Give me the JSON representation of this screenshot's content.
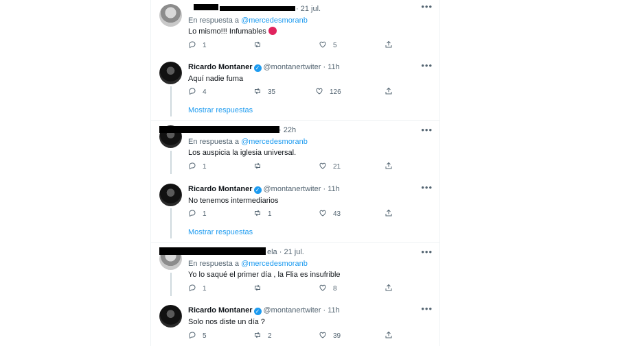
{
  "tweets": [
    {
      "id": "t1",
      "time": "21 jul.",
      "reply_prefix": "En respuesta a",
      "reply_handle": "@mercedesmoranb",
      "text": "Lo mismo!!! Infumables",
      "counts": {
        "reply": "1",
        "retweet": "",
        "like": "5"
      }
    },
    {
      "id": "t2",
      "name": "Ricardo Montaner",
      "handle": "@montanertwiter",
      "time": "11h",
      "text": "Aquí nadie fuma",
      "counts": {
        "reply": "4",
        "retweet": "35",
        "like": "126"
      }
    },
    {
      "id": "t3",
      "time": "22h",
      "reply_prefix": "En respuesta a",
      "reply_handle": "@mercedesmoranb",
      "text": "Los auspicia la iglesia universal.",
      "counts": {
        "reply": "1",
        "retweet": "",
        "like": "21"
      }
    },
    {
      "id": "t4",
      "name": "Ricardo Montaner",
      "handle": "@montanertwiter",
      "time": "11h",
      "text": "No tenemos intermediarios",
      "counts": {
        "reply": "1",
        "retweet": "1",
        "like": "43"
      }
    },
    {
      "id": "t5",
      "name_fragment": "ela",
      "time": "21 jul.",
      "reply_prefix": "En respuesta a",
      "reply_handle": "@mercedesmoranb",
      "text": "Yo lo saqué el primer día , la Flia es insufrible",
      "counts": {
        "reply": "1",
        "retweet": "",
        "like": "8"
      }
    },
    {
      "id": "t6",
      "name": "Ricardo Montaner",
      "handle": "@montanertwiter",
      "time": "11h",
      "text": "Solo nos diste un día ?",
      "counts": {
        "reply": "5",
        "retweet": "2",
        "like": "39"
      }
    }
  ],
  "show_replies_label": "Mostrar respuestas",
  "more_glyph": "•••",
  "colors": {
    "accent": "#1d9bf0",
    "secondary": "#536471",
    "thread_line": "#cfd9de"
  }
}
